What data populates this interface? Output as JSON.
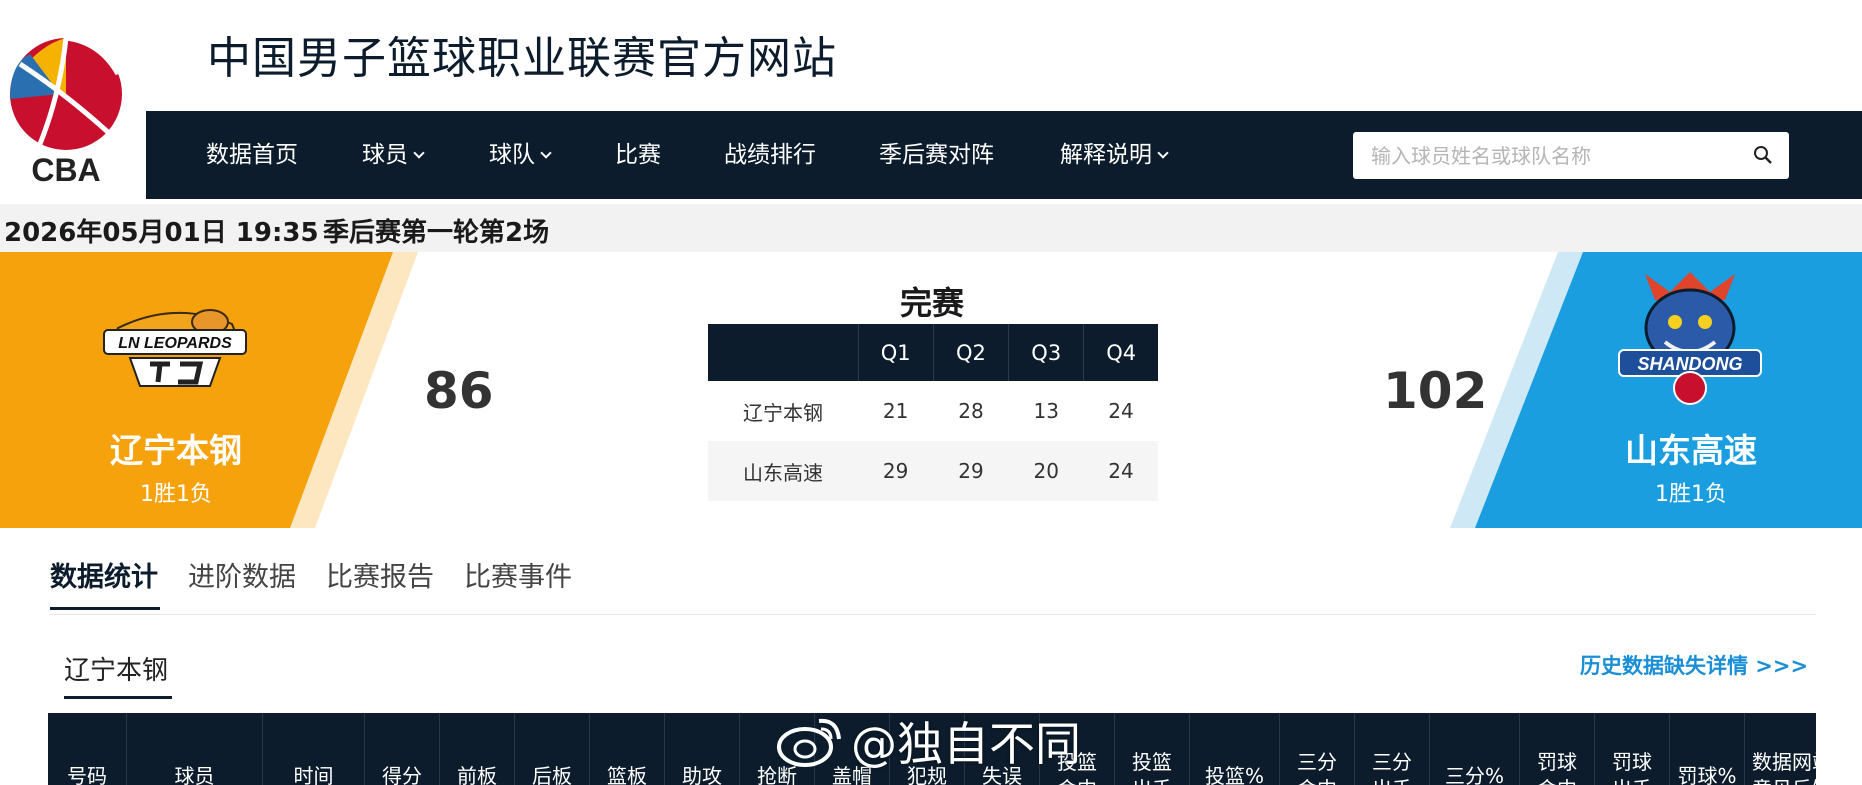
{
  "header": {
    "site_title": "中国男子篮球职业联赛官方网站",
    "logo_text": "CBA"
  },
  "nav": {
    "items": [
      {
        "label": "数据首页",
        "dropdown": false
      },
      {
        "label": "球员",
        "dropdown": true
      },
      {
        "label": "球队",
        "dropdown": true
      },
      {
        "label": "比赛",
        "dropdown": false
      },
      {
        "label": "战绩排行",
        "dropdown": false
      },
      {
        "label": "季后赛对阵",
        "dropdown": false
      },
      {
        "label": "解释说明",
        "dropdown": true
      }
    ],
    "search_placeholder": "输入球员姓名或球队名称"
  },
  "game": {
    "datetime": "2026年05月01日 19:35",
    "round": "季后赛第一轮第2场",
    "status": "完赛",
    "home": {
      "name": "辽宁本钢",
      "record": "1胜1负",
      "score": "86",
      "logo_text": "LN LEOPARDS",
      "color": "#f5a20c"
    },
    "away": {
      "name": "山东高速",
      "record": "1胜1负",
      "score": "102",
      "logo_text": "SHANDONG",
      "color": "#1a9ee0"
    },
    "quarters": {
      "headers": [
        "Q1",
        "Q2",
        "Q3",
        "Q4"
      ],
      "rows": [
        {
          "team": "辽宁本钢",
          "scores": [
            "21",
            "28",
            "13",
            "24"
          ]
        },
        {
          "team": "山东高速",
          "scores": [
            "29",
            "29",
            "20",
            "24"
          ]
        }
      ]
    }
  },
  "tabs": [
    {
      "label": "数据统计",
      "active": true
    },
    {
      "label": "进阶数据",
      "active": false
    },
    {
      "label": "比赛报告",
      "active": false
    },
    {
      "label": "比赛事件",
      "active": false
    }
  ],
  "stats_section": {
    "team_title": "辽宁本钢",
    "history_link": "历史数据缺失详情 >>>",
    "columns": [
      "号码",
      "球员",
      "时间",
      "得分",
      "前板",
      "后板",
      "篮板",
      "助攻",
      "抢断",
      "盖帽",
      "犯规",
      "失误",
      "投篮\n命中",
      "投篮\n出手",
      "投篮%",
      "三分\n命中",
      "三分\n出手",
      "三分%",
      "罚球\n命中",
      "罚球\n出手",
      "罚球%",
      "数据网站\n意见反馈"
    ]
  },
  "watermark": {
    "text": "@独自不同"
  },
  "colors": {
    "navy": "#0c1c2c",
    "orange": "#f5a20c",
    "blue": "#1a9ee0",
    "link": "#1a8fd6"
  }
}
